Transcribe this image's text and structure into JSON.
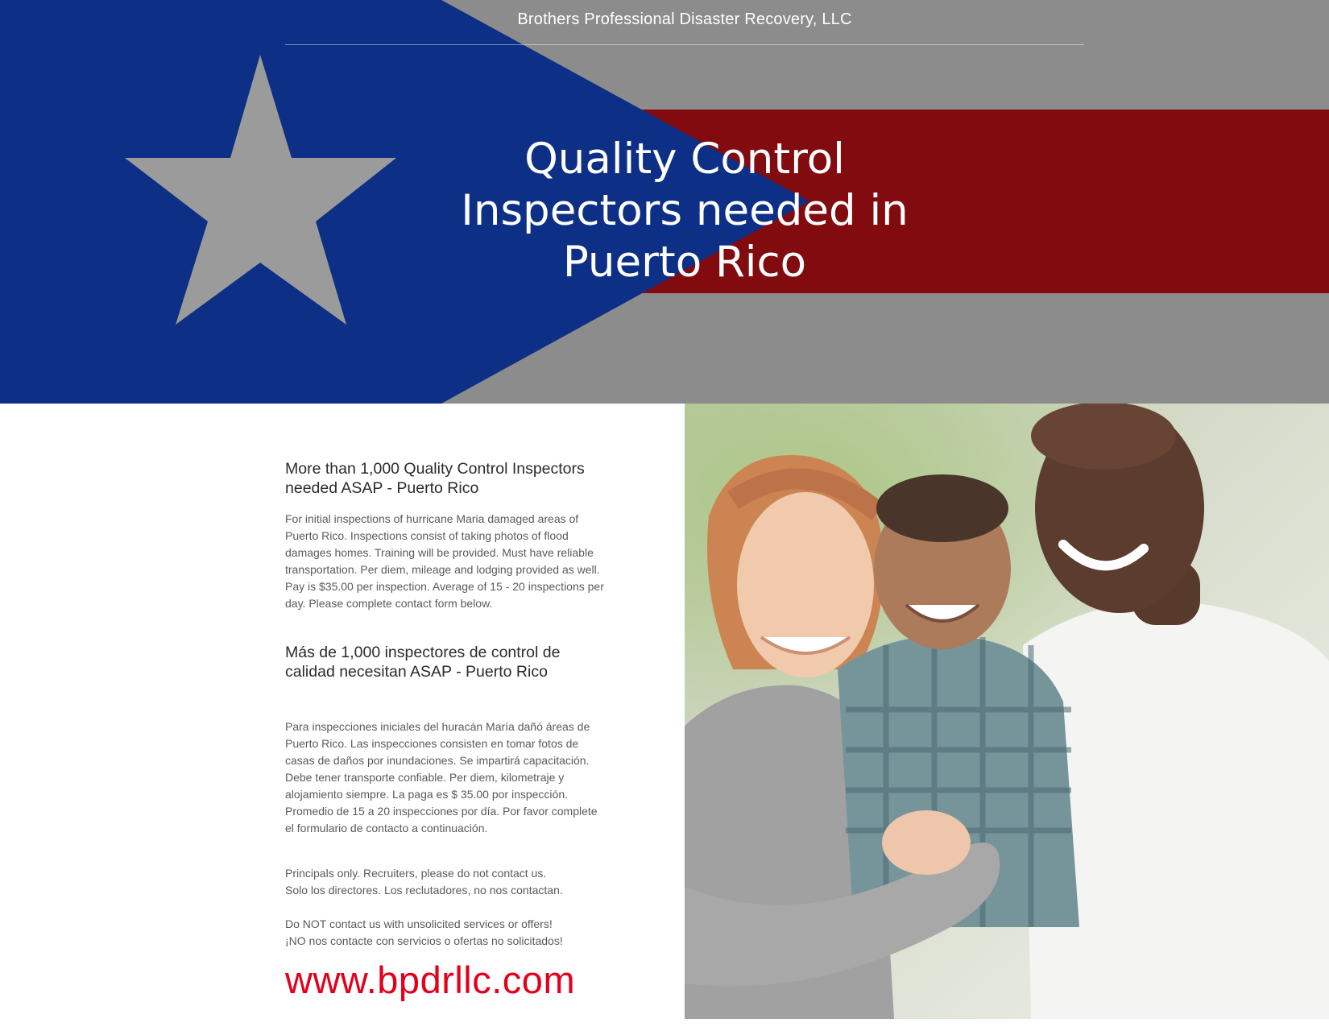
{
  "brand": {
    "name": "Brothers Professional Disaster Recovery, LLC"
  },
  "hero": {
    "title": "Quality Control\nInspectors needed in\nPuerto Rico",
    "flag_colors": {
      "triangle_blue": "#0d2f86",
      "stripe_red": "#820b10",
      "stripe_gray": "#8c8c8c",
      "star_gray": "#9b9b9b"
    }
  },
  "content": {
    "english": {
      "heading": "More than 1,000 Quality Control Inspectors needed ASAP - Puerto Rico",
      "body": "For initial inspections of hurricane Maria damaged areas of Puerto Rico.  Inspections consist of taking photos of flood damages homes. Training will be provided. Must have reliable transportation. Per diem, mileage and lodging provided as well. Pay is $35.00 per inspection. Average of 15 - 20 inspections per day. Please complete contact form below."
    },
    "spanish": {
      "heading": "Más de 1,000 inspectores de control de calidad necesitan ASAP - Puerto Rico",
      "body": "Para inspecciones iniciales del huracán María dañó áreas de Puerto Rico. Las inspecciones consisten en tomar fotos de casas de daños por inundaciones. Se impartirá capacitación. Debe tener transporte confiable. Per diem, kilometraje y alojamiento siempre. La paga es $ 35.00 por inspección. Promedio de 15 a 20 inspecciones por día. Por favor complete el formulario de contacto a continuación."
    },
    "principals_note": "Principals only. Recruiters, please do not contact us.\nSolo los directores. Los reclutadores, no nos contactan.",
    "unsolicited_note": "Do NOT contact us with unsolicited services or offers!\n¡NO nos contacte con servicios o ofertas no solicitados!",
    "website": "www.bpdrllc.com",
    "accent_color": "#e3001b"
  },
  "photo": {
    "subject": "smiling family photo"
  }
}
